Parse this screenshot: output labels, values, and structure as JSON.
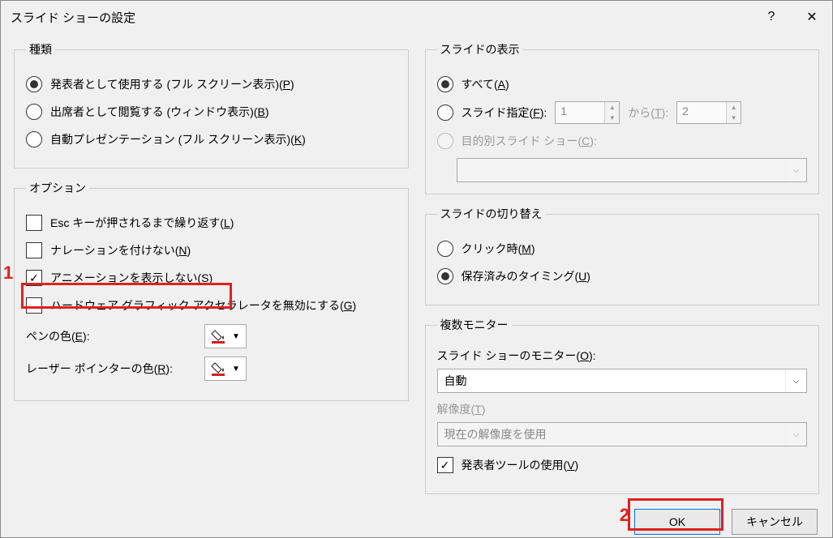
{
  "title": "スライド ショーの設定",
  "titlebar": {
    "help": "?",
    "close": "✕"
  },
  "type_group": {
    "legend": "種類",
    "opt_presenter_pre": "発表者として使用する (フル スクリーン表示)(",
    "opt_presenter_u": "P",
    "opt_browse_pre": "出席者として閲覧する (ウィンドウ表示)(",
    "opt_browse_u": "B",
    "opt_kiosk_pre": "自動プレゼンテーション (フル スクリーン表示)(",
    "opt_kiosk_u": "K",
    "close_paren": ")"
  },
  "options_group": {
    "legend": "オプション",
    "loop_pre": "Esc キーが押されるまで繰り返す(",
    "loop_u": "L",
    "no_narr_pre": "ナレーションを付けない(",
    "no_narr_u": "N",
    "no_anim_pre": "アニメーションを表示しない(",
    "no_anim_u": "S",
    "no_hw_pre": "ハードウェア グラフィック アクセラレータを無効にする(",
    "no_hw_u": "G",
    "close_paren": ")",
    "pen_color_pre": "ペンの色(",
    "pen_color_u": "E",
    "laser_color_pre": "レーザー ポインターの色(",
    "laser_color_u": "R"
  },
  "show_group": {
    "legend": "スライドの表示",
    "all_pre": "すべて(",
    "all_u": "A",
    "range_pre": "スライド指定(",
    "range_u": "F",
    "range_suffix": "):",
    "from_val": "1",
    "to_pre": "から(",
    "to_u": "T",
    "to_suffix": "):",
    "to_val": "2",
    "custom_pre": "目的別スライド ショー(",
    "custom_u": "C",
    "custom_suffix": "):",
    "close_paren": ")"
  },
  "advance_group": {
    "legend": "スライドの切り替え",
    "manual_pre": "クリック時(",
    "manual_u": "M",
    "timing_pre": "保存済みのタイミング(",
    "timing_u": "U",
    "close_paren": ")"
  },
  "monitor_group": {
    "legend": "複数モニター",
    "monitor_pre": "スライド ショーのモニター(",
    "monitor_u": "O",
    "monitor_suffix": "):",
    "monitor_val": "自動",
    "res_pre": "解像度(",
    "res_u": "T",
    "res_suffix": ")",
    "res_val": "現在の解像度を使用",
    "presenter_pre": "発表者ツールの使用(",
    "presenter_u": "V",
    "close_paren": ")"
  },
  "buttons": {
    "ok": "OK",
    "cancel": "キャンセル"
  },
  "callouts": {
    "n1": "1",
    "n2": "2"
  },
  "colors": {
    "pen": "#d02020",
    "laser": "#d02020"
  }
}
